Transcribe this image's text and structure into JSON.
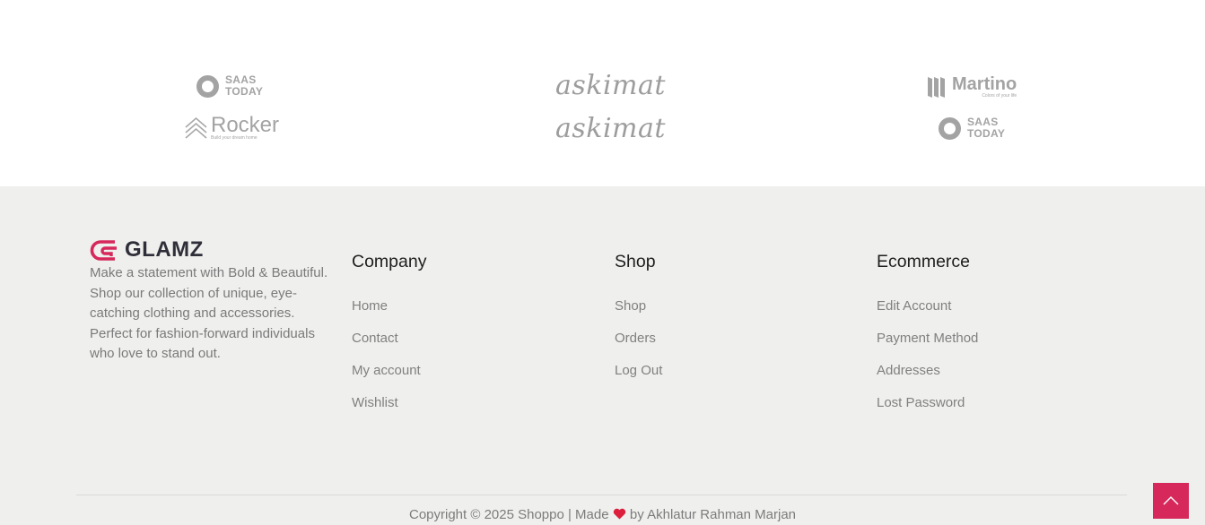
{
  "brands": {
    "saas_top_left": {
      "line1": "SAAS",
      "line2": "TODAY"
    },
    "rocker": {
      "name": "Rocker",
      "tagline": "Build your dream home"
    },
    "askimat_1": "askimat",
    "askimat_2": "askimat",
    "martino": {
      "name": "Martino",
      "tagline": "Colors of your life"
    },
    "saas_right": {
      "line1": "SAAS",
      "line2": "TODAY"
    }
  },
  "footer": {
    "logo_text": "GLAMZ",
    "about": "Make a statement with Bold & Beautiful. Shop our collection of unique, eye-catching clothing and accessories. Perfect for fashion-forward individuals who love to stand out.",
    "company": {
      "title": "Company",
      "links": [
        "Home",
        "Contact",
        "My account",
        "Wishlist"
      ]
    },
    "shop": {
      "title": "Shop",
      "links": [
        "Shop",
        "Orders",
        "Log Out"
      ]
    },
    "ecommerce": {
      "title": "Ecommerce",
      "links": [
        "Edit Account",
        "Payment Method",
        "Addresses",
        "Lost Password"
      ]
    },
    "copyright_pre": "Copyright © 2025 Shoppo | Made",
    "copyright_post": "by Akhlatur Rahman Marjan"
  },
  "colors": {
    "accent": "#d6285b",
    "footer_bg": "#efefed",
    "heart": "#dc1f3d"
  },
  "icons": {
    "scroll_top": "chevron-up-icon",
    "heart": "heart-icon",
    "logo": "glamz-logo-icon"
  }
}
